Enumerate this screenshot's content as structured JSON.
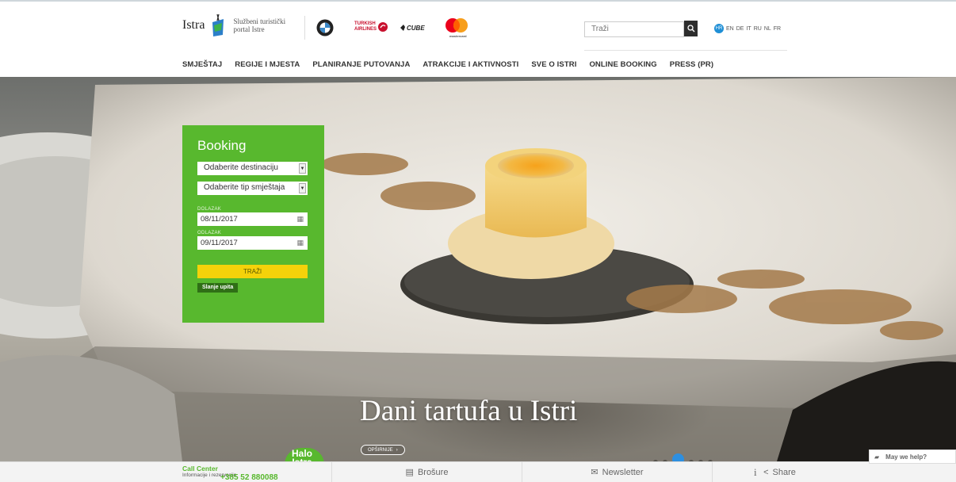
{
  "header": {
    "logo_word": "Istra",
    "logo_tagline_1": "Službeni turistički",
    "logo_tagline_2": "portal Istre",
    "sponsors": [
      {
        "name": "BMW",
        "icon": "bmw-logo-icon"
      },
      {
        "name": "TURKISH AIRLINES",
        "icon": "turkish-airlines-logo-icon"
      },
      {
        "name": "CUBE",
        "icon": "cube-logo-icon"
      },
      {
        "name": "mastercard",
        "icon": "mastercard-logo-icon"
      }
    ],
    "search_placeholder": "Traži",
    "search_icon": "search-icon",
    "languages": [
      "HR",
      "EN",
      "DE",
      "IT",
      "RU",
      "NL",
      "FR"
    ],
    "active_language": "HR"
  },
  "nav": {
    "items": [
      "SMJEŠTAJ",
      "REGIJE I MJESTA",
      "PLANIRANJE PUTOVANJA",
      "ATRAKCIJE I AKTIVNOSTI",
      "SVE O ISTRI",
      "ONLINE BOOKING",
      "PRESS (PR)"
    ]
  },
  "booking": {
    "title": "Booking",
    "destination_select": "Odaberite destinaciju",
    "accommodation_select": "Odaberite tip smještaja",
    "arrival_label": "DOLAZAK",
    "arrival_value": "08/11/2017",
    "departure_label": "ODLAZAK",
    "departure_value": "09/11/2017",
    "search_button": "TRAŽI",
    "inquiry_button": "Slanje upita"
  },
  "hero": {
    "title": "Dani tartufa u Istri",
    "more_button": "OPŠIRNIJE",
    "slides_count": 6,
    "active_slide": 3
  },
  "footer": {
    "call_center_title": "Call Center",
    "call_center_sub": "Informacije i rezervacije",
    "phone": "+385 52 880088",
    "halo_line1": "Halo",
    "halo_line2": "Istra",
    "links": [
      {
        "label": "Brošure",
        "icon": "book-icon"
      },
      {
        "label": "Newsletter",
        "icon": "envelope-icon"
      },
      {
        "label": "Share",
        "icon": "share-icon"
      }
    ],
    "info_icon": "info-icon",
    "help_label": "May we help?"
  },
  "colors": {
    "brand_green": "#58b82e",
    "search_yellow": "#f4d20a",
    "active_blue": "#2d8fe0"
  }
}
